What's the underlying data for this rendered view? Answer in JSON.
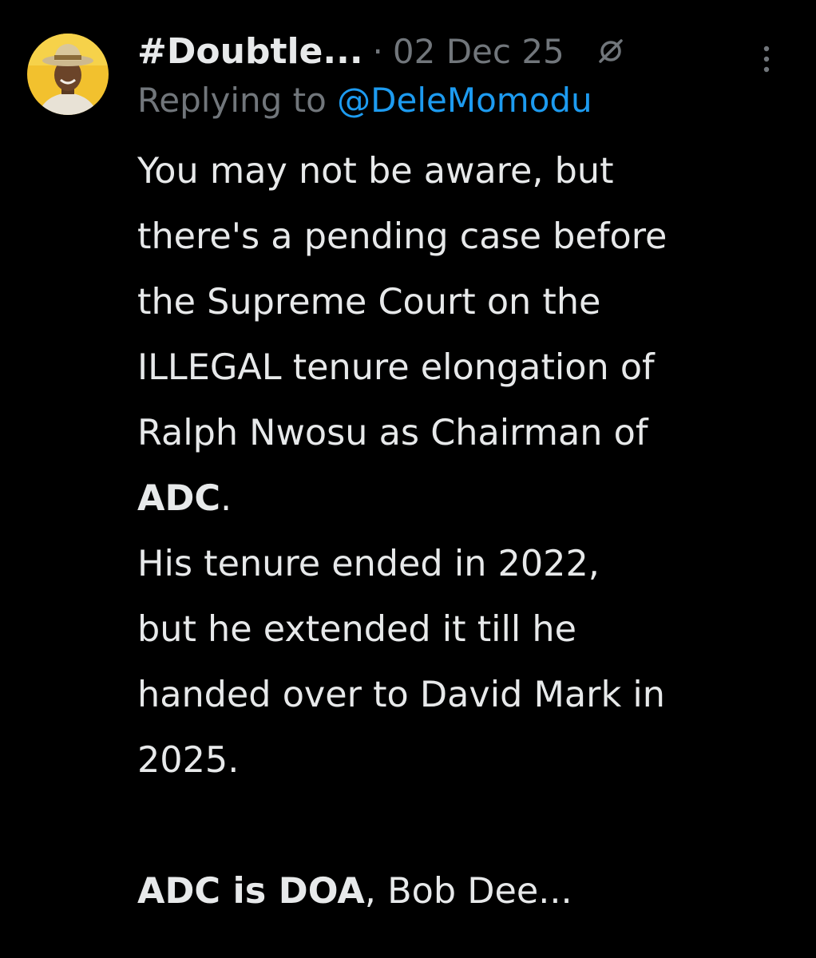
{
  "author": {
    "display_name": "#Doubtle...",
    "avatar_icon": "profile-avatar"
  },
  "meta": {
    "separator": "·",
    "date": "02 Dec 25"
  },
  "reply": {
    "prefix": "Replying to",
    "handle": "@DeleMomodu"
  },
  "body": {
    "line1": "You may not be aware, but",
    "line2": "there's a pending case before",
    "line3": "the Supreme Court on the",
    "line4": "ILLEGAL tenure elongation of",
    "line5": "Ralph Nwosu as Chairman of",
    "line6_bold": "ADC",
    "line6_rest": ".",
    "line7": "His tenure ended in 2022,",
    "line8": "but he extended it till he",
    "line9": "handed over to David Mark in",
    "line10": "2025.",
    "line11_bold": "ADC is DOA",
    "line11_rest": ", Bob Dee..."
  },
  "icons": {
    "grok": "grok-icon",
    "more": "more-options-icon"
  },
  "colors": {
    "background": "#000000",
    "text": "#e7e9ea",
    "muted": "#71767b",
    "link": "#1d9bf0",
    "avatar_bg": "#f5c518"
  }
}
